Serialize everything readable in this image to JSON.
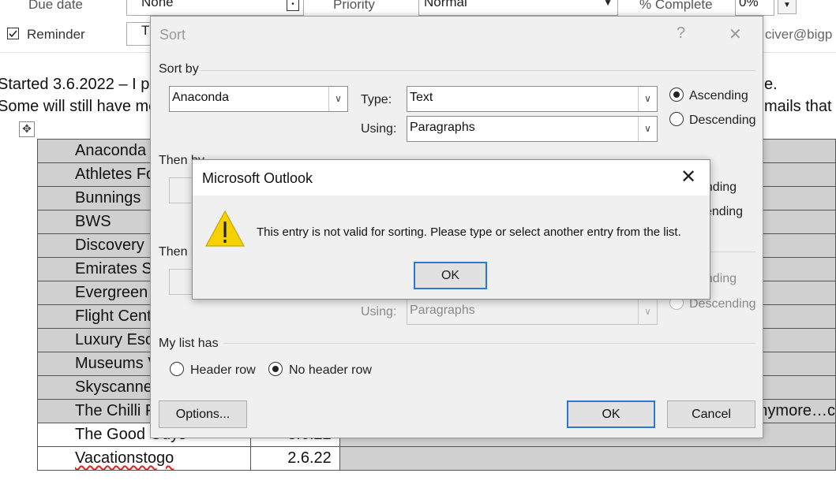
{
  "task_form": {
    "due_date_label": "Due date",
    "due_date_value": "None",
    "priority_label": "Priority",
    "priority_value": "Normal",
    "complete_label": "% Complete",
    "complete_value": "0%",
    "reminder_label": "Reminder",
    "reminder_field_text": "T",
    "email_fragment": "civer@bigp"
  },
  "document": {
    "line1_left": "Started 3.6.2022 – I pu",
    "line1_right": "e.",
    "line2_left": "Some will still have me",
    "line2_right": "mails that",
    "right_table_text": "anymore…c"
  },
  "table": {
    "rows": [
      {
        "name": "Anaconda",
        "date": ""
      },
      {
        "name": "Athletes Fo",
        "date": ""
      },
      {
        "name": "Bunnings",
        "date": ""
      },
      {
        "name": "BWS",
        "date": ""
      },
      {
        "name": "Discovery I",
        "date": ""
      },
      {
        "name": "Emirates S",
        "date": ""
      },
      {
        "name": "Evergreen",
        "date": ""
      },
      {
        "name": "Flight Cent",
        "date": ""
      },
      {
        "name": "Luxury Esca",
        "date": ""
      },
      {
        "name": "Museums V",
        "date": ""
      },
      {
        "name": "Skyscanner",
        "date": ""
      },
      {
        "name": "The Chilli F",
        "date": ""
      },
      {
        "name": "The Good Guys",
        "date": "3.6.22"
      },
      {
        "name": "Vacationstogo",
        "date": "2.6.22"
      }
    ]
  },
  "sort_dialog": {
    "title": "Sort",
    "help_glyph": "?",
    "close_glyph": "✕",
    "sort_by_label": "Sort by",
    "sort_by_value": "Anaconda",
    "type_label": "Type:",
    "type_value": "Text",
    "using_label": "Using:",
    "using_value": "Paragraphs",
    "ascending_label": "Ascending",
    "descending_label": "Descending",
    "then_by_1_label": "Then by",
    "then_by_2_label": "Then by",
    "then_by_2_using_label": "Using:",
    "then_by_2_using_value": "Paragraphs",
    "then_by_2_descending_label": "Descending",
    "partial_ascending_1": "ending",
    "partial_descending_1": "cending",
    "partial_ascending_2": "ending",
    "my_list_has_label": "My list has",
    "header_row_label": "Header row",
    "no_header_row_label": "No header row",
    "options_button": "Options...",
    "ok_button": "OK",
    "cancel_button": "Cancel"
  },
  "message_box": {
    "title": "Microsoft Outlook",
    "message": "This entry is not valid for sorting. Please type or select another entry from the list.",
    "ok_button": "OK",
    "close_glyph": "✕",
    "icon": "warning-icon"
  },
  "colors": {
    "accent_blue": "#2a77d4",
    "warning_yellow": "#f5d100",
    "table_gray": "#d0d0d0",
    "dialog_bg": "#f0f0f0"
  }
}
